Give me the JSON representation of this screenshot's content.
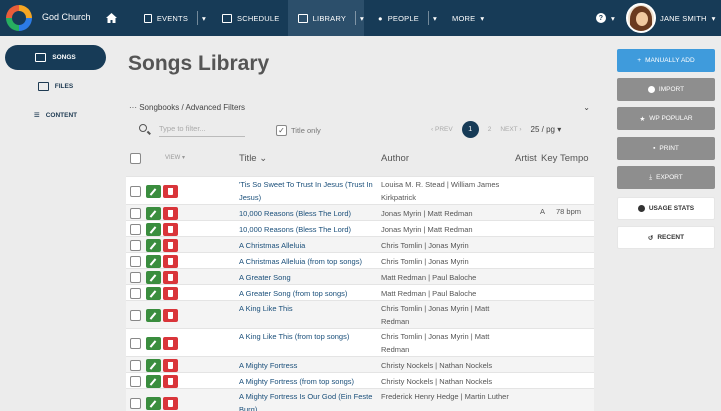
{
  "brand": "God Church",
  "nav": {
    "events": "EVENTS",
    "schedule": "SCHEDULE",
    "library": "LIBRARY",
    "people": "PEOPLE",
    "more": "MORE",
    "user_name": "JANE SMITH"
  },
  "sidebar": {
    "items": [
      {
        "label": "SONGS",
        "icon": "songs-icon"
      },
      {
        "label": "FILES",
        "icon": "folder-icon"
      },
      {
        "label": "CONTENT",
        "icon": "list-icon"
      }
    ]
  },
  "main": {
    "title": "Songs Library",
    "filters_label": "Songbooks / Advanced Filters",
    "search_placeholder": "Type to filter...",
    "title_only": "Title only",
    "pager": {
      "prev": "PREV",
      "page1": "1",
      "page2": "2",
      "next": "NEXT",
      "per_page": "25 / pg"
    },
    "columns": {
      "view": "VIEW",
      "title": "Title",
      "author": "Author",
      "artist": "Artist",
      "key": "Key",
      "tempo": "Tempo"
    },
    "rows": [
      {
        "title": "'Tis So Sweet To Trust In Jesus (Trust In Jesus)",
        "author": "Louisa M. R. Stead | William James Kirkpatrick",
        "key": "",
        "tempo": ""
      },
      {
        "title": "10,000 Reasons (Bless The Lord)",
        "author": "Jonas Myrin | Matt Redman",
        "key": "A",
        "tempo": "78 bpm"
      },
      {
        "title": "10,000 Reasons (Bless The Lord)",
        "author": "Jonas Myrin | Matt Redman",
        "key": "",
        "tempo": ""
      },
      {
        "title": "A Christmas Alleluia",
        "author": "Chris Tomlin | Jonas Myrin",
        "key": "",
        "tempo": ""
      },
      {
        "title": "A Christmas Alleluia (from top songs)",
        "author": "Chris Tomlin | Jonas Myrin",
        "key": "",
        "tempo": ""
      },
      {
        "title": "A Greater Song",
        "author": "Matt Redman | Paul Baloche",
        "key": "",
        "tempo": ""
      },
      {
        "title": "A Greater Song (from top songs)",
        "author": "Matt Redman | Paul Baloche",
        "key": "",
        "tempo": ""
      },
      {
        "title": "A King Like This",
        "author": "Chris Tomlin | Jonas Myrin | Matt Redman",
        "key": "",
        "tempo": ""
      },
      {
        "title": "A King Like This (from top songs)",
        "author": "Chris Tomlin | Jonas Myrin | Matt Redman",
        "key": "",
        "tempo": ""
      },
      {
        "title": "A Mighty Fortress",
        "author": "Christy Nockels | Nathan Nockels",
        "key": "",
        "tempo": ""
      },
      {
        "title": "A Mighty Fortress (from top songs)",
        "author": "Christy Nockels | Nathan Nockels",
        "key": "",
        "tempo": ""
      },
      {
        "title": "A Mighty Fortress Is Our God (Ein Feste Burg)",
        "author": "Frederick Henry Hedge | Martin Luther",
        "key": "",
        "tempo": ""
      }
    ]
  },
  "right": {
    "manually_add": "MANUALLY ADD",
    "import": "IMPORT",
    "wp_popular": "WP POPULAR",
    "print": "PRINT",
    "export": "EXPORT",
    "usage_stats": "USAGE STATS",
    "recent": "RECENT"
  },
  "colors": {
    "nav_bg": "#173b57",
    "primary": "#3f9bdc",
    "edit": "#3a8d3e",
    "delete": "#d9353a"
  }
}
